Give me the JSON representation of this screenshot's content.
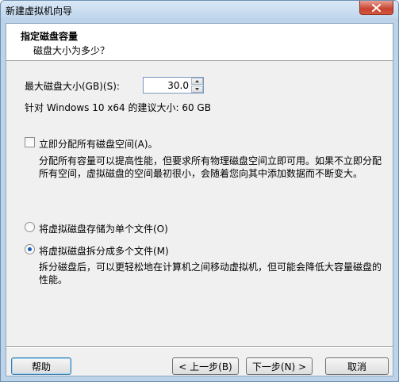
{
  "window": {
    "title": "新建虚拟机向导"
  },
  "header": {
    "title": "指定磁盘容量",
    "subtitle": "磁盘大小为多少？"
  },
  "disk_size": {
    "label": "最大磁盘大小(GB)(S):",
    "value": "30.0",
    "recommendation": "针对 Windows 10 x64 的建议大小: 60 GB"
  },
  "allocate": {
    "label": "立即分配所有磁盘空间(A)。",
    "checked": false,
    "description": "分配所有容量可以提高性能，但要求所有物理磁盘空间立即可用。如果不立即分配所有空间，虚拟磁盘的空间最初很小，会随着您向其中添加数据而不断变大。"
  },
  "storage": {
    "single_label": "将虚拟磁盘存储为单个文件(O)",
    "multi_label": "将虚拟磁盘拆分成多个文件(M)",
    "selected": "multi",
    "multi_description": "拆分磁盘后，可以更轻松地在计算机之间移动虚拟机，但可能会降低大容量磁盘的性能。"
  },
  "footer": {
    "help_label": "帮助",
    "back_label": "< 上一步(B)",
    "next_label": "下一步(N) >",
    "cancel_label": "取消"
  },
  "icons": {
    "close": "close-icon",
    "spin_up": "chevron-up-icon",
    "spin_down": "chevron-down-icon"
  }
}
